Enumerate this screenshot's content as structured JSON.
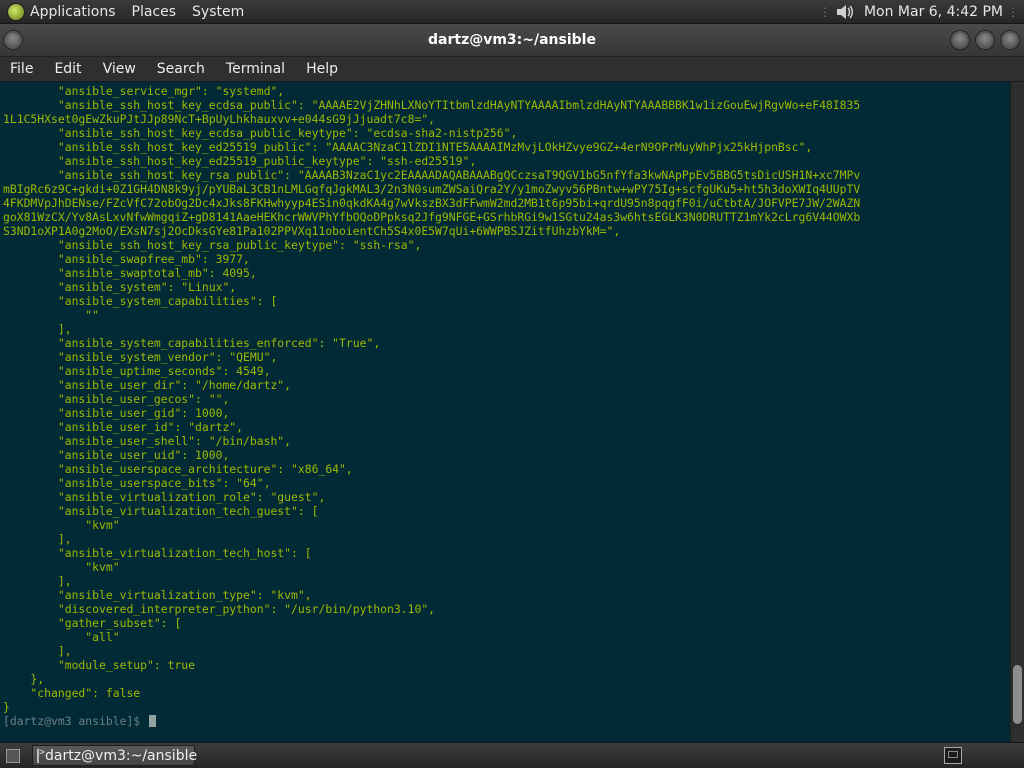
{
  "top_panel": {
    "menus": [
      "Applications",
      "Places",
      "System"
    ],
    "clock": "Mon Mar  6,  4:42 PM"
  },
  "window": {
    "title": "dartz@vm3:~/ansible"
  },
  "menubar": {
    "items": [
      "File",
      "Edit",
      "View",
      "Search",
      "Terminal",
      "Help"
    ]
  },
  "terminal": {
    "lines": [
      "        \"ansible_service_mgr\": \"systemd\",",
      "        \"ansible_ssh_host_key_ecdsa_public\": \"AAAAE2VjZHNhLXNoYTItbmlzdHAyNTYAAAAIbmlzdHAyNTYAAABBBK1w1izGouEwjRgvWo+eF48I835",
      "1L1C5HXset0gEwZkuPJtJJp89NcT+BpUyLhkhauxvv+e044sG9jJjuadt7c8=\",",
      "        \"ansible_ssh_host_key_ecdsa_public_keytype\": \"ecdsa-sha2-nistp256\",",
      "        \"ansible_ssh_host_key_ed25519_public\": \"AAAAC3NzaC1lZDI1NTE5AAAAIMzMvjLOkHZvye9GZ+4erN9OPrMuyWhPjx25kHjpnBsc\",",
      "        \"ansible_ssh_host_key_ed25519_public_keytype\": \"ssh-ed25519\",",
      "        \"ansible_ssh_host_key_rsa_public\": \"AAAAB3NzaC1yc2EAAAADAQABAAABgQCczsaT9QGV1bG5nfYfa3kwNApPpEv5BBG5tsDicUSH1N+xc7MPv",
      "mBIgRc6z9C+gkdi+0Z1GH4DN8k9yj/pYUBaL3CB1nLMLGqfqJgkMAL3/2n3N0sumZWSaiQra2Y/y1moZwyv56PBntw+wPY75Ig+scfgUKu5+ht5h3doXWIq4UUpTV",
      "4FKDMVpJhDENse/FZcVfC72obOg2Dc4xJks8FKHwhyyp4ESin0qkdKA4g7wVkszBX3dFFwmW2md2MB1t6p95bi+qrdU95n8pqgfF0i/uCtbtA/JOFVPE7JW/2WAZN",
      "goX81WzCX/Yv8AsLxvNfwWmgqiZ+gD8141AaeHEKhcrWWVPhYfbOQoDPpksq2Jfg9NFGE+GSrhbRGi9w1SGtu24as3w6htsEGLK3N0DRUTTZ1mYk2cLrg6V44OWXb",
      "S3ND1oXP1A0g2MoO/EXsN7sj2OcDksGYe81Pa102PPVXq11oboientCh5S4x0E5W7qUi+6WWPBSJZitfUhzbYkM=\",",
      "        \"ansible_ssh_host_key_rsa_public_keytype\": \"ssh-rsa\",",
      "        \"ansible_swapfree_mb\": 3977,",
      "        \"ansible_swaptotal_mb\": 4095,",
      "        \"ansible_system\": \"Linux\",",
      "        \"ansible_system_capabilities\": [",
      "            \"\"",
      "        ],",
      "        \"ansible_system_capabilities_enforced\": \"True\",",
      "        \"ansible_system_vendor\": \"QEMU\",",
      "        \"ansible_uptime_seconds\": 4549,",
      "        \"ansible_user_dir\": \"/home/dartz\",",
      "        \"ansible_user_gecos\": \"\",",
      "        \"ansible_user_gid\": 1000,",
      "        \"ansible_user_id\": \"dartz\",",
      "        \"ansible_user_shell\": \"/bin/bash\",",
      "        \"ansible_user_uid\": 1000,",
      "        \"ansible_userspace_architecture\": \"x86_64\",",
      "        \"ansible_userspace_bits\": \"64\",",
      "        \"ansible_virtualization_role\": \"guest\",",
      "        \"ansible_virtualization_tech_guest\": [",
      "            \"kvm\"",
      "        ],",
      "        \"ansible_virtualization_tech_host\": [",
      "            \"kvm\"",
      "        ],",
      "        \"ansible_virtualization_type\": \"kvm\",",
      "        \"discovered_interpreter_python\": \"/usr/bin/python3.10\",",
      "        \"gather_subset\": [",
      "            \"all\"",
      "        ],",
      "        \"module_setup\": true",
      "    },",
      "    \"changed\": false",
      "}"
    ],
    "prompt": "[dartz@vm3 ansible]$ "
  },
  "scrollbar": {
    "position": 0.97,
    "visible_fraction": 0.09
  },
  "taskbar": {
    "task_label": "dartz@vm3:~/ansible"
  },
  "icons": {
    "panel_logo": "gnome-foot-icon",
    "sound": "speaker-icon",
    "task": "terminal-icon",
    "tray": "workspace-switcher-icon"
  },
  "colors": {
    "terminal_bg": "#002b36",
    "terminal_fg": "#9fb800",
    "prompt": "#6c7f84"
  }
}
